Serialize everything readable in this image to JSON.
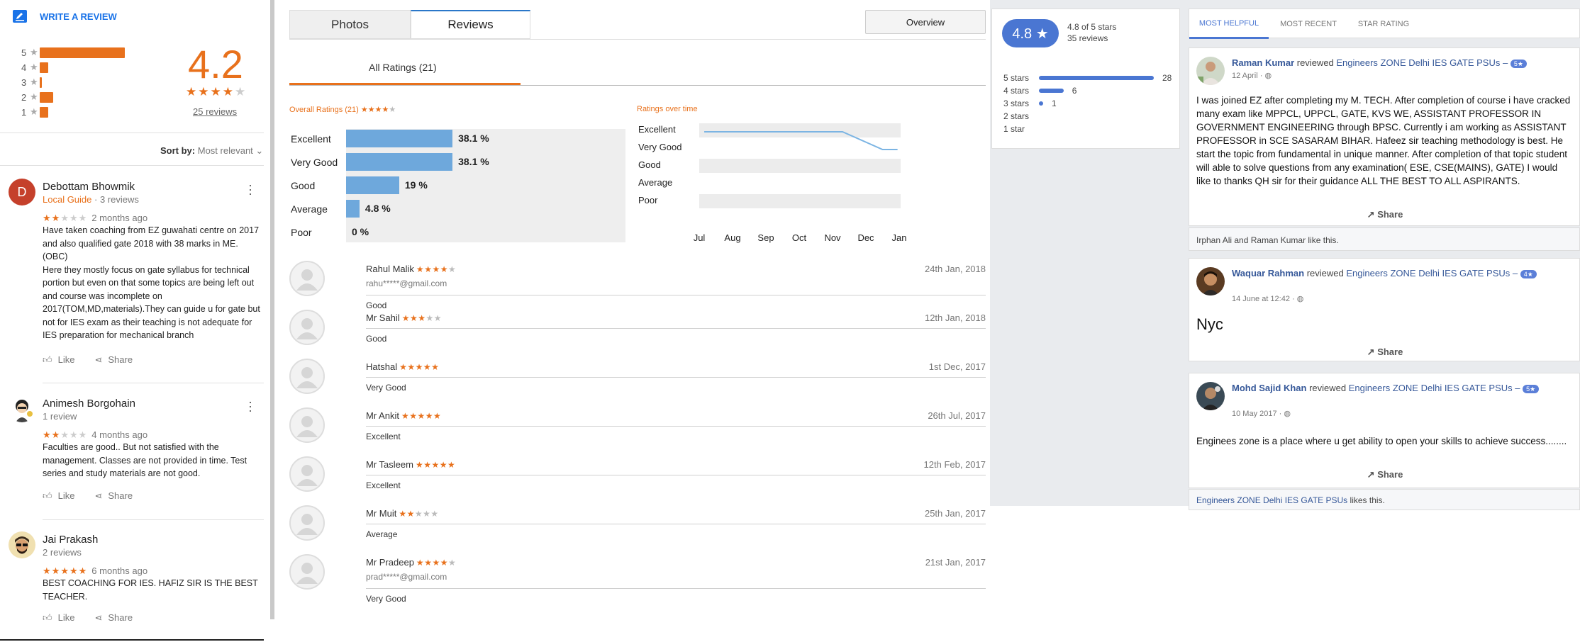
{
  "google": {
    "write_review": "WRITE A REVIEW",
    "histogram": [
      {
        "label": "5",
        "fraction": 1.0
      },
      {
        "label": "4",
        "fraction": 0.1
      },
      {
        "label": "3",
        "fraction": 0.02
      },
      {
        "label": "2",
        "fraction": 0.16
      },
      {
        "label": "1",
        "fraction": 0.1
      }
    ],
    "average": "4.2",
    "avg_stars": 4,
    "review_count": "25 reviews",
    "sort_label": "Sort by:",
    "sort_value": "Most relevant",
    "reviews": [
      {
        "initial": "D",
        "name": "Debottam Bhowmik",
        "badge": "Local Guide",
        "meta": " · 3 reviews",
        "stars": 2,
        "ago": "2 months ago",
        "text": "Have taken coaching from EZ guwahati centre on 2017 and also qualified gate 2018 with 38 marks in ME. (OBC)\nHere they mostly focus on gate syllabus for technical portion but even on that some topics are being left out and course was incomplete on 2017(TOM,MD,materials).They can guide u for gate but not for IES exam as their teaching is not adequate for IES preparation for mechanical branch",
        "like": "Like",
        "share": "Share"
      },
      {
        "initial": "",
        "name": "Animesh Borgohain",
        "badge": "",
        "meta": "1 review",
        "stars": 2,
        "ago": "4 months ago",
        "text": "Faculties are good.. But not satisfied with the management. Classes are not provided in time.  Test series and study materials are not good.",
        "like": "Like",
        "share": "Share"
      },
      {
        "initial": "",
        "name": "Jai Prakash",
        "badge": "",
        "meta": "2 reviews",
        "stars": 5,
        "ago": "6 months ago",
        "text": "BEST COACHING FOR IES. HAFIZ SIR IS THE BEST TEACHER.",
        "like": "Like",
        "share": "Share"
      }
    ]
  },
  "site": {
    "tabs": [
      "Photos",
      "Reviews"
    ],
    "overview_button": "Overview",
    "all_ratings": "All Ratings (21)",
    "overall_title": "Overall Ratings (21)",
    "overall_stars": 4,
    "overtime_title": "Ratings over time",
    "reviews": [
      {
        "name": "Rahul Malik",
        "stars": 4,
        "date": "24th Jan, 2018",
        "email": "rahu*****@gmail.com",
        "comment": "Good"
      },
      {
        "name": "Mr Sahil",
        "stars": 3,
        "date": "12th Jan, 2018",
        "email": "",
        "comment": "Good"
      },
      {
        "name": "Hatshal",
        "stars": 4.5,
        "date": "1st Dec, 2017",
        "email": "",
        "comment": "Very Good"
      },
      {
        "name": "Mr Ankit",
        "stars": 5,
        "date": "26th Jul, 2017",
        "email": "",
        "comment": "Excellent"
      },
      {
        "name": "Mr Tasleem",
        "stars": 5,
        "date": "12th Feb, 2017",
        "email": "",
        "comment": "Excellent"
      },
      {
        "name": "Mr Muit",
        "stars": 2,
        "date": "25th Jan, 2017",
        "email": "",
        "comment": "Average"
      },
      {
        "name": "Mr Pradeep",
        "stars": 4,
        "date": "21st Jan, 2017",
        "email": "prad*****@gmail.com",
        "comment": "Very Good"
      }
    ]
  },
  "facebook": {
    "score": "4.8 ★",
    "of_stars": "4.8 of 5 stars",
    "count": "35 reviews",
    "breakdown": [
      {
        "label": "5 stars",
        "value": 28
      },
      {
        "label": "4 stars",
        "value": 6
      },
      {
        "label": "3 stars",
        "value": 1
      },
      {
        "label": "2 stars",
        "value": null
      },
      {
        "label": "1 star",
        "value": null
      }
    ],
    "tabs": [
      "MOST HELPFUL",
      "MOST RECENT",
      "STAR RATING"
    ],
    "posts": [
      {
        "author": "Raman Kumar",
        "verb": " reviewed ",
        "page": "Engineers ZONE Delhi IES GATE PSUs –",
        "badge": "5★",
        "time": "12 April · ",
        "text": "I was joined EZ after completing my M. TECH. After completion of course i have cracked many exam like MPPCL, UPPCL, GATE, KVS WE, ASSISTANT PROFESSOR IN GOVERNMENT ENGINEERING through BPSC. Currently i am working as ASSISTANT PROFESSOR in SCE SASARAM BIHAR. Hafeez sir teaching methodology is best. He start the topic from fundamental in unique manner. After completion of that topic student will able to solve questions from any examination( ESE, CSE(MAINS), GATE) I would like to thanks QH sir for their guidance ALL THE BEST TO ALL ASPIRANTS.",
        "share": "Share",
        "footer": "Irphan Ali and Raman Kumar like this."
      },
      {
        "author": "Waquar Rahman",
        "verb": " reviewed ",
        "page": "Engineers ZONE Delhi IES GATE PSUs –",
        "badge": "4★",
        "time": "14 June at 12:42 · ",
        "text": "Nyc",
        "share": "Share",
        "footer": ""
      },
      {
        "author": "Mohd Sajid Khan",
        "verb": " reviewed ",
        "page": "Engineers ZONE Delhi IES GATE PSUs –",
        "badge": "5★",
        "time": "10 May 2017 · ",
        "text": "Enginees zone is a place where u get ability to open your skills to achieve success........",
        "share": "Share",
        "footer_page": "Engineers ZONE Delhi IES GATE PSUs",
        "footer": " likes this."
      }
    ]
  },
  "chart_data": [
    {
      "type": "bar",
      "title": "Overall Ratings (21)",
      "categories": [
        "Excellent",
        "Very Good",
        "Good",
        "Average",
        "Poor"
      ],
      "values": [
        38.1,
        38.1,
        19,
        4.8,
        0
      ],
      "labels": [
        "38.1 %",
        "38.1 %",
        "19 %",
        "4.8 %",
        "0 %"
      ]
    },
    {
      "type": "line",
      "title": "Ratings over time",
      "x": [
        "Jul",
        "Aug",
        "Sep",
        "Oct",
        "Nov",
        "Dec",
        "Jan"
      ],
      "y_categories": [
        "Excellent",
        "Very Good",
        "Good",
        "Average",
        "Poor"
      ],
      "series": [
        {
          "points": [
            [
              0.15,
              "Excellent"
            ],
            [
              4.3,
              "Excellent"
            ],
            [
              5.5,
              "Very Good"
            ],
            [
              5.95,
              "Very Good"
            ]
          ]
        }
      ]
    },
    {
      "type": "bar",
      "categories": [
        "5 stars",
        "4 stars",
        "3 stars",
        "2 stars",
        "1 star"
      ],
      "values": [
        28,
        6,
        1,
        0,
        0
      ]
    }
  ]
}
